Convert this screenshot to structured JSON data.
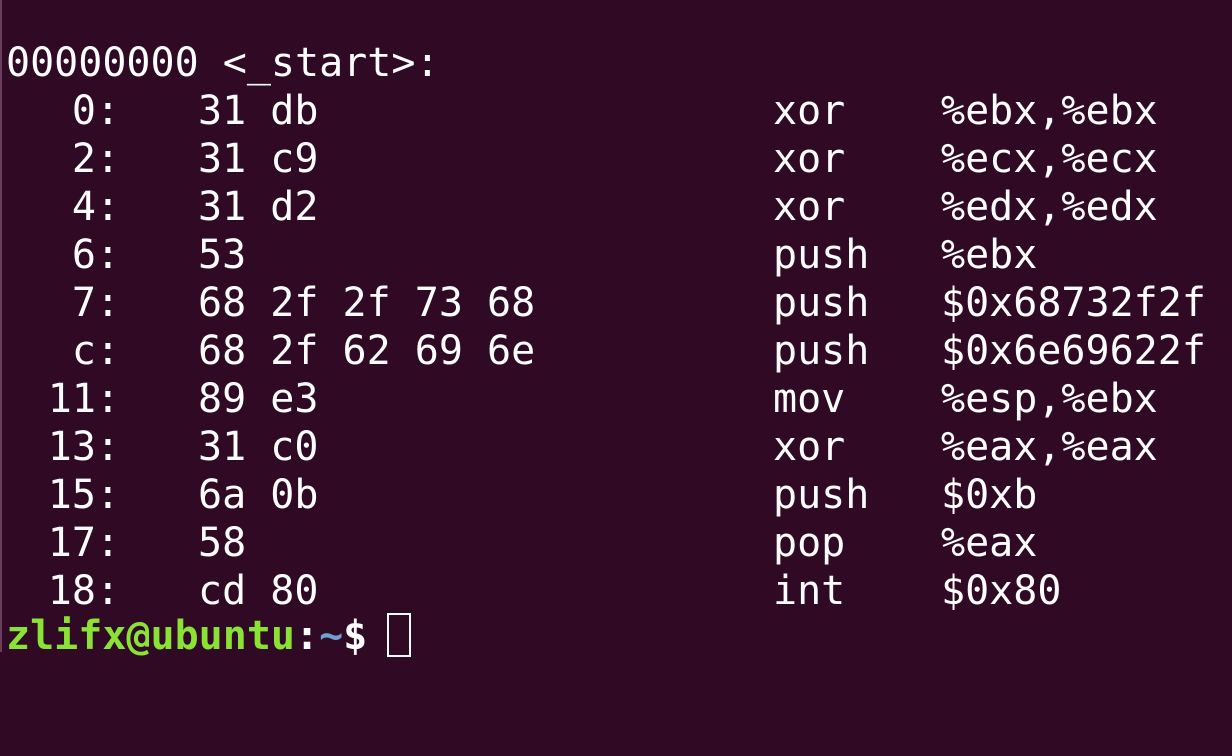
{
  "terminal": {
    "background": "#300a24",
    "section_label": "00000000 <_start>:",
    "rows": [
      {
        "addr": "0:",
        "bytes": "31 db",
        "mnemonic": "xor",
        "operands": "%ebx,%ebx"
      },
      {
        "addr": "2:",
        "bytes": "31 c9",
        "mnemonic": "xor",
        "operands": "%ecx,%ecx"
      },
      {
        "addr": "4:",
        "bytes": "31 d2",
        "mnemonic": "xor",
        "operands": "%edx,%edx"
      },
      {
        "addr": "6:",
        "bytes": "53",
        "mnemonic": "push",
        "operands": "%ebx"
      },
      {
        "addr": "7:",
        "bytes": "68 2f 2f 73 68",
        "mnemonic": "push",
        "operands": "$0x68732f2f"
      },
      {
        "addr": "c:",
        "bytes": "68 2f 62 69 6e",
        "mnemonic": "push",
        "operands": "$0x6e69622f"
      },
      {
        "addr": "11:",
        "bytes": "89 e3",
        "mnemonic": "mov",
        "operands": "%esp,%ebx"
      },
      {
        "addr": "13:",
        "bytes": "31 c0",
        "mnemonic": "xor",
        "operands": "%eax,%eax"
      },
      {
        "addr": "15:",
        "bytes": "6a 0b",
        "mnemonic": "push",
        "operands": "$0xb"
      },
      {
        "addr": "17:",
        "bytes": "58",
        "mnemonic": "pop",
        "operands": "%eax"
      },
      {
        "addr": "18:",
        "bytes": "cd 80",
        "mnemonic": "int",
        "operands": "$0x80"
      }
    ],
    "prompt": {
      "user_host": "zlifx@ubuntu",
      "colon": ":",
      "path": "~",
      "symbol": "$",
      "user_color": "#8ae234",
      "path_color": "#729fcf"
    }
  }
}
